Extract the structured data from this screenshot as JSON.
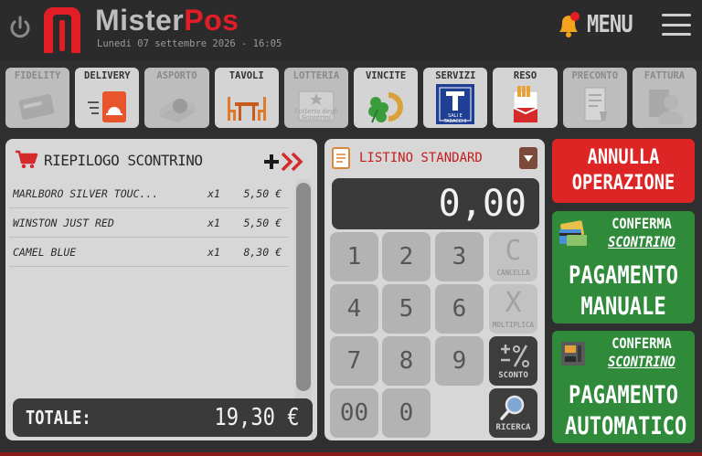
{
  "header": {
    "brand_part1": "Mister",
    "brand_part2": "Pos",
    "datetime": "Lunedi 07 settembre 2026 - 16:05",
    "menu_label": "MENU"
  },
  "toolbar": [
    {
      "label": "FIDELITY",
      "icon": "fidelity-card-icon",
      "enabled": false
    },
    {
      "label": "DELIVERY",
      "icon": "delivery-icon",
      "enabled": true
    },
    {
      "label": "ASPORTO",
      "icon": "takeaway-icon",
      "enabled": false
    },
    {
      "label": "TAVOLI",
      "icon": "tables-icon",
      "enabled": true
    },
    {
      "label": "LOTTERIA",
      "icon": "lottery-icon",
      "enabled": false
    },
    {
      "label": "VINCITE",
      "icon": "winnings-icon",
      "enabled": true
    },
    {
      "label": "SERVIZI",
      "icon": "tabacchi-icon",
      "enabled": true
    },
    {
      "label": "RESO",
      "icon": "return-icon",
      "enabled": true
    },
    {
      "label": "PRECONTO",
      "icon": "preconto-icon",
      "enabled": false
    },
    {
      "label": "FATTURA",
      "icon": "invoice-icon",
      "enabled": false
    }
  ],
  "tabacchi_badge": "SALI E TABACCHI",
  "lotteria_badge": "Lotteria degli Scontrini",
  "receipt": {
    "title": "RIEPILOGO SCONTRINO",
    "items": [
      {
        "name": "MARLBORO SILVER TOUC...",
        "qty": "x1",
        "price": "5,50 €"
      },
      {
        "name": "WINSTON JUST RED",
        "qty": "x1",
        "price": "5,50 €"
      },
      {
        "name": "CAMEL BLUE",
        "qty": "x1",
        "price": "8,30 €"
      }
    ],
    "total_label": "TOTALE:",
    "total_value": "19,30 €"
  },
  "listino": {
    "title": "LISTINO STANDARD",
    "display": "0,00",
    "keys": {
      "k1": "1",
      "k2": "2",
      "k3": "3",
      "k4": "4",
      "k5": "5",
      "k6": "6",
      "k7": "7",
      "k8": "8",
      "k9": "9",
      "k00": "00",
      "k0": "0",
      "cancel_glyph": "C",
      "cancel_label": "CANCELLA",
      "mult_glyph": "X",
      "mult_label": "MOLTIPLICA",
      "discount_label": "SCONTO",
      "search_label": "RICERCA"
    }
  },
  "actions": {
    "annulla_line1": "ANNULLA",
    "annulla_line2": "OPERAZIONE",
    "manual": {
      "conf1": "CONFERMA",
      "conf2": "SCONTRINO",
      "line1": "PAGAMENTO",
      "line2": "MANUALE"
    },
    "auto": {
      "conf1": "CONFERMA",
      "conf2": "SCONTRINO",
      "line1": "PAGAMENTO",
      "line2": "AUTOMATICO"
    }
  },
  "colors": {
    "brand_red": "#e21d26",
    "annulla": "#dd2525",
    "confirm_green": "#2f8a3a",
    "panel": "#d7d7d7",
    "background": "#2f2f2f"
  }
}
